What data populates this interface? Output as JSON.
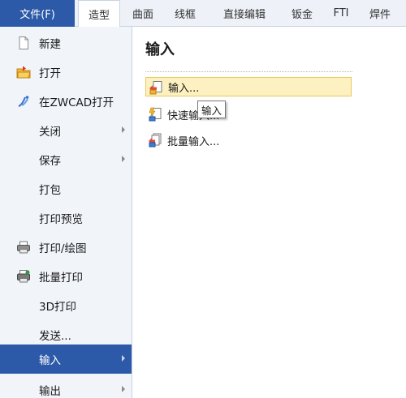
{
  "ribbon": {
    "file_tab": "文件(F)",
    "tabs": [
      "造型",
      "曲面",
      "线框",
      "直接编辑",
      "钣金",
      "FTI",
      "焊件"
    ],
    "active_tab_index": 0
  },
  "menu": {
    "items": [
      {
        "label": "新建",
        "icon": "new-document-icon",
        "has_submenu": false
      },
      {
        "label": "打开",
        "icon": "open-folder-icon",
        "has_submenu": false
      },
      {
        "label": "在ZWCAD打开",
        "icon": "zwcad-icon",
        "has_submenu": false
      },
      {
        "label": "关闭",
        "icon": "",
        "has_submenu": true
      },
      {
        "label": "保存",
        "icon": "",
        "has_submenu": true
      },
      {
        "label": "打包",
        "icon": "",
        "has_submenu": false
      },
      {
        "label": "打印预览",
        "icon": "",
        "has_submenu": false
      },
      {
        "label": "打印/绘图",
        "icon": "printer-icon",
        "has_submenu": false
      },
      {
        "label": "批量打印",
        "icon": "batch-printer-icon",
        "has_submenu": false
      },
      {
        "label": "3D打印",
        "icon": "",
        "has_submenu": false
      },
      {
        "label": "发送...",
        "icon": "",
        "has_submenu": false
      },
      {
        "label": "输入",
        "icon": "",
        "has_submenu": true,
        "selected": true
      },
      {
        "label": "输出",
        "icon": "",
        "has_submenu": true
      }
    ]
  },
  "pane": {
    "title": "输入",
    "items": [
      {
        "label": "输入...",
        "icon": "import-icon",
        "hover": true
      },
      {
        "label": "快速输入...",
        "icon": "quick-import-icon",
        "hover": false
      },
      {
        "label": "批量输入...",
        "icon": "batch-import-icon",
        "hover": false
      }
    ]
  },
  "tooltip": {
    "text": "输入"
  },
  "colors": {
    "accent": "#2c5aa8",
    "menu_bg": "#f1f4f9",
    "hover_bg": "#fdf1c2"
  }
}
